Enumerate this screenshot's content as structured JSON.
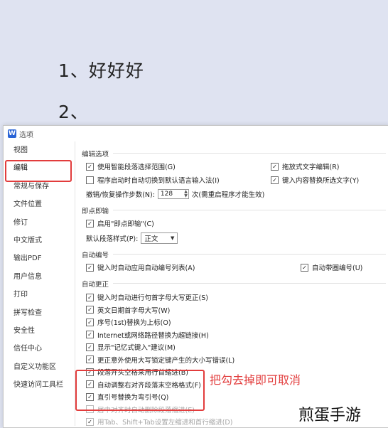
{
  "document": {
    "line1": "1、好好好",
    "line2": "2、"
  },
  "dialog": {
    "title": "选项",
    "logo_letter": "W"
  },
  "sidebar": {
    "items": [
      {
        "label": "视图"
      },
      {
        "label": "编辑"
      },
      {
        "label": "常规与保存"
      },
      {
        "label": "文件位置"
      },
      {
        "label": "修订"
      },
      {
        "label": "中文版式"
      },
      {
        "label": "输出PDF"
      },
      {
        "label": "用户信息"
      },
      {
        "label": "打印"
      },
      {
        "label": "拼写检查"
      },
      {
        "label": "安全性"
      },
      {
        "label": "信任中心"
      },
      {
        "label": "自定义功能区"
      },
      {
        "label": "快速访问工具栏"
      }
    ],
    "selected": "编辑"
  },
  "edit_options": {
    "section_title": "编辑选项",
    "smart_paragraph": {
      "label": "使用智能段落选择范围(G)",
      "checked": true
    },
    "drag_text": {
      "label": "拖放式文字编辑(R)",
      "checked": true
    },
    "auto_switch_lang": {
      "label": "程序启动时自动切换到默认语言输入法(I)",
      "checked": false
    },
    "replace_selection": {
      "label": "键入内容替换所选文字(Y)",
      "checked": true
    },
    "undo_steps": {
      "label": "撤销/恢复操作步数(N):",
      "value": "128",
      "suffix": "次(需重启程序才能生效)"
    }
  },
  "click_and_type": {
    "section_title": "即点即输",
    "enable": {
      "label": "启用\"即点即输\"(C)",
      "checked": true
    },
    "default_style": {
      "label": "默认段落样式(P):",
      "value": "正文"
    }
  },
  "auto_numbering": {
    "section_title": "自动编号",
    "auto_list": {
      "label": "键入时自动应用自动编号列表(A)",
      "checked": true
    },
    "auto_circled": {
      "label": "自动带圈编号(U)",
      "checked": true
    }
  },
  "auto_correct": {
    "section_title": "自动更正",
    "items": [
      {
        "label": "键入时自动进行句首字母大写更正(S)",
        "checked": true,
        "disabled": false
      },
      {
        "label": "英文日期首字母大写(W)",
        "checked": true,
        "disabled": false
      },
      {
        "label": "序号(1st)替换为上标(O)",
        "checked": true,
        "disabled": false
      },
      {
        "label": "Internet或网络路径替换为超链接(H)",
        "checked": true,
        "disabled": false
      },
      {
        "label": "显示\"记忆式键入\"建议(M)",
        "checked": true,
        "disabled": false
      },
      {
        "label": "更正意外使用大写锁定键产生的大小写错误(L)",
        "checked": true,
        "disabled": false
      },
      {
        "label": "段落开头空格采用行首缩进(B)",
        "checked": true,
        "disabled": false
      },
      {
        "label": "自动调整右对齐段落末空格格式(F)",
        "checked": true,
        "disabled": false
      },
      {
        "label": "直引号替换为弯引号(Q)",
        "checked": true,
        "disabled": false
      },
      {
        "label": "居中对齐时自动删除段落缩进(E)",
        "checked": false,
        "disabled": true
      },
      {
        "label": "用Tab、Shift+Tab设置左缩进和首行缩进(D)",
        "checked": true,
        "disabled": true
      }
    ]
  },
  "annotation": {
    "text": "把勾去掉即可取消",
    "color": "#e23c3c"
  },
  "watermark": {
    "text": "煎蛋手游"
  }
}
